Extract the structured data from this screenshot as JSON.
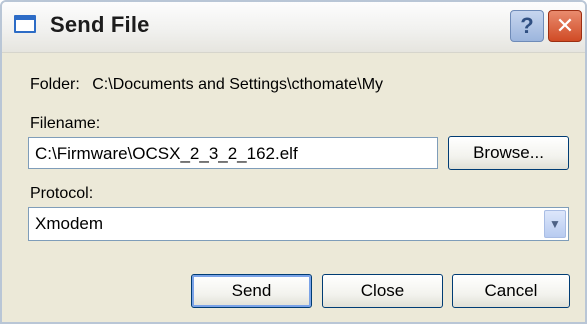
{
  "window": {
    "title": "Send File",
    "help_label": "?",
    "close_label": "✕"
  },
  "folder": {
    "label": "Folder:",
    "value": "C:\\Documents and Settings\\cthomate\\My"
  },
  "filename": {
    "label": "Filename:",
    "value": "C:\\Firmware\\OCSX_2_3_2_162.elf",
    "browse_label": "Browse..."
  },
  "protocol": {
    "label": "Protocol:",
    "selected": "Xmodem",
    "arrow": "▼"
  },
  "buttons": {
    "send": "Send",
    "close": "Close",
    "cancel": "Cancel"
  },
  "colors": {
    "accent": "#003c74",
    "close_button": "#d04b25"
  }
}
